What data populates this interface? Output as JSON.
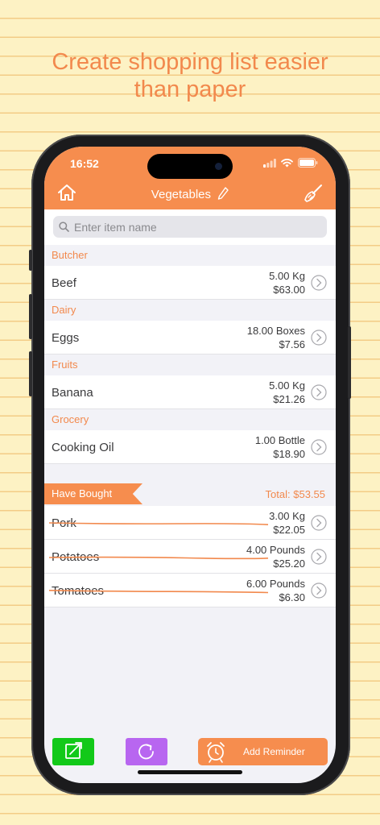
{
  "headline": {
    "line1": "Create shopping list easier",
    "line2": "than paper"
  },
  "status_bar": {
    "time": "16:52"
  },
  "nav": {
    "title": "Vegetables",
    "home_icon": "home-icon",
    "edit_icon": "pencil-icon",
    "clear_icon": "broom-icon"
  },
  "search": {
    "placeholder": "Enter item name"
  },
  "sections": [
    {
      "title": "Butcher",
      "items": [
        {
          "name": "Beef",
          "qty": "5.00 Kg",
          "price": "$63.00"
        }
      ]
    },
    {
      "title": "Dairy",
      "items": [
        {
          "name": "Eggs",
          "qty": "18.00 Boxes",
          "price": "$7.56"
        }
      ]
    },
    {
      "title": "Fruits",
      "items": [
        {
          "name": "Banana",
          "qty": "5.00 Kg",
          "price": "$21.26"
        }
      ]
    },
    {
      "title": "Grocery",
      "items": [
        {
          "name": "Cooking Oil",
          "qty": "1.00 Bottle",
          "price": "$18.90"
        }
      ]
    }
  ],
  "bought": {
    "label": "Have Bought",
    "total": "Total: $53.55",
    "items": [
      {
        "name": "Pork",
        "qty": "3.00 Kg",
        "price": "$22.05"
      },
      {
        "name": "Potatoes",
        "qty": "4.00 Pounds",
        "price": "$25.20"
      },
      {
        "name": "Tomatoes",
        "qty": "6.00 Pounds",
        "price": "$6.30"
      }
    ]
  },
  "toolbar": {
    "reminder_label": "Add Reminder"
  },
  "colors": {
    "accent": "#f68d4e",
    "green_button": "#12c919",
    "purple_button": "#b866f0",
    "background_paper": "#fdf2c4"
  }
}
